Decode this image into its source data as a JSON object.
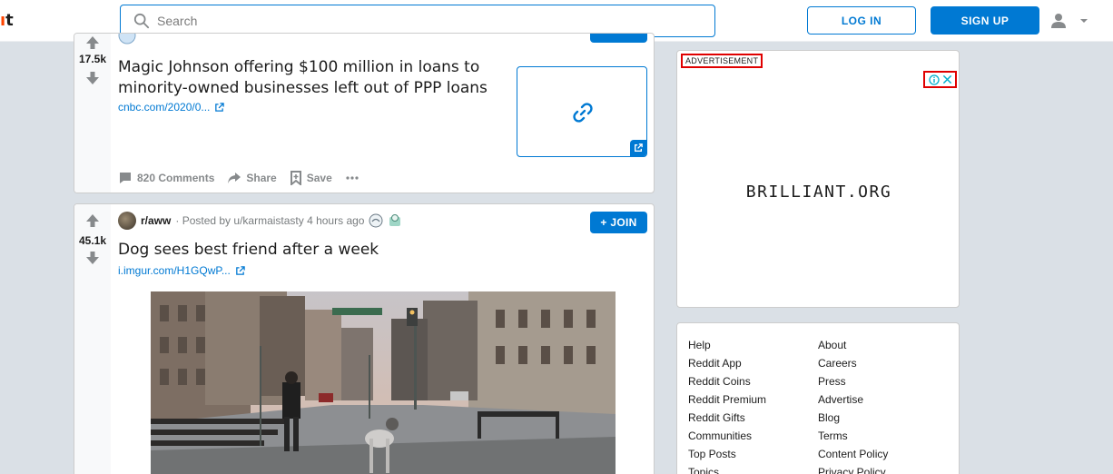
{
  "header": {
    "logo_fragment": "it",
    "search_placeholder": "Search",
    "login_label": "LOG IN",
    "signup_label": "SIGN UP"
  },
  "posts": [
    {
      "score": "17.5k",
      "title": "Magic Johnson offering $100 million in loans to minority-owned businesses left out of PPP loans",
      "link_text": "cnbc.com/2020/0...",
      "comments_label": "820 Comments",
      "share_label": "Share",
      "save_label": "Save"
    },
    {
      "score": "45.1k",
      "subreddit": "r/aww",
      "posted_by": "· Posted by u/karmaistasty 4 hours ago",
      "join_label": "+ JOIN",
      "title": "Dog sees best friend after a week",
      "link_text": "i.imgur.com/H1GQwP..."
    }
  ],
  "ad": {
    "label": "ADVERTISEMENT",
    "brand": "BRILLIANT.ORG"
  },
  "footer_links": {
    "col1": [
      "Help",
      "Reddit App",
      "Reddit Coins",
      "Reddit Premium",
      "Reddit Gifts",
      "Communities",
      "Top Posts",
      "Topics"
    ],
    "col2": [
      "About",
      "Careers",
      "Press",
      "Advertise",
      "Blog",
      "Terms",
      "Content Policy",
      "Privacy Policy"
    ]
  },
  "colors": {
    "accent": "#0079d3",
    "background": "#dae0e6",
    "ad_highlight": "#e00000"
  }
}
